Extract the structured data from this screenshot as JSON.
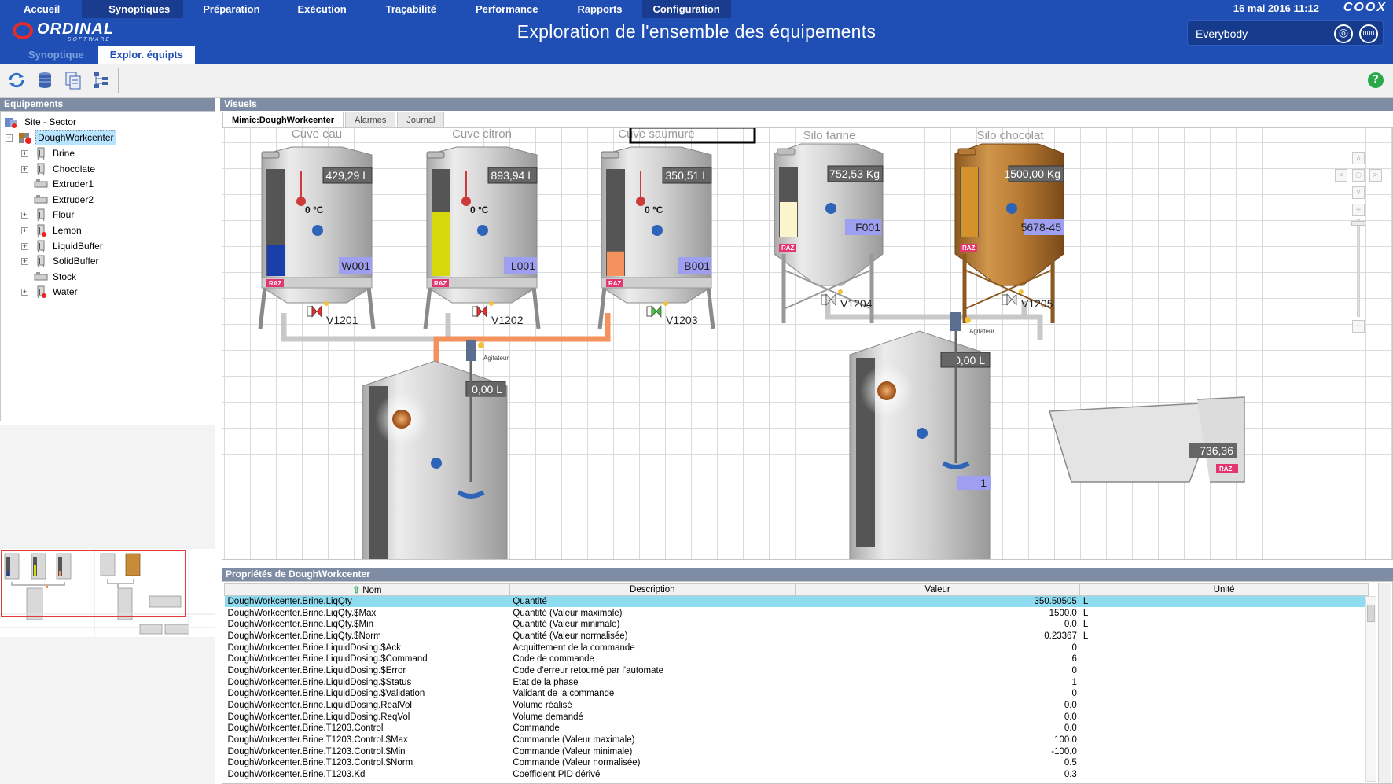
{
  "nav": {
    "items": [
      "Accueil",
      "Synoptiques",
      "Préparation",
      "Exécution",
      "Traçabilité",
      "Performance",
      "Rapports",
      "Configuration"
    ],
    "active": [
      "Synoptiques",
      "Configuration"
    ]
  },
  "logo": {
    "word": "ORDINAL",
    "sub": "SOFTWARE"
  },
  "header": {
    "title": "Exploration de l'ensemble des équipements",
    "datetime": "16 mai 2016 11:12",
    "brand": "COOX",
    "user": "Everybody",
    "user_btn_1": "◎",
    "user_btn_2": "000"
  },
  "subtabs": {
    "synoptique": "Synoptique",
    "explor": "Explor. équipts"
  },
  "toolbar": {
    "help": "?"
  },
  "left_panel": {
    "title": "Equipements",
    "tree": {
      "root": "Site - Sector",
      "workcenter": "DoughWorkcenter",
      "children": [
        "Brine",
        "Chocolate",
        "Extruder1",
        "Extruder2",
        "Flour",
        "Lemon",
        "LiquidBuffer",
        "SolidBuffer",
        "Stock",
        "Water"
      ]
    }
  },
  "visuels": {
    "title": "Visuels",
    "tabs": [
      "Mimic:DoughWorkcenter",
      "Alarmes",
      "Journal"
    ]
  },
  "mimic": {
    "tanks": [
      {
        "title": "Cuve eau",
        "volume": "429,29 L",
        "temp": "0 °C",
        "code": "W001",
        "valve": "V1201",
        "fill_color": "#1a3faa",
        "fill_level": 0.29
      },
      {
        "title": "Cuve citron",
        "volume": "893,94 L",
        "temp": "0 °C",
        "code": "L001",
        "valve": "V1202",
        "fill_color": "#d6d80c",
        "fill_level": 0.6
      },
      {
        "title": "Cuve saumure",
        "volume": "350,51 L",
        "temp": "0 °C",
        "code": "B001",
        "valve": "V1203",
        "fill_color": "#f4925e",
        "fill_level": 0.23
      }
    ],
    "silos": [
      {
        "title": "Silo farine",
        "volume": "752,53 Kg",
        "code": "F001",
        "valve": "V1204",
        "fill_color": "#fbf4cc",
        "fill_level": 0.5
      },
      {
        "title": "Silo chocolat",
        "volume": "1500,00 Kg",
        "code": "5678-45",
        "valve": "V1205",
        "fill_color": "#d4922a",
        "fill_level": 1.0
      }
    ],
    "mixer_left": {
      "volume": "0,00 L",
      "agitator": "Agitateur"
    },
    "mixer_right": {
      "volume": "0,00 L",
      "agitator": "Agitateur",
      "code": "1"
    },
    "bin": {
      "value": "736,36"
    },
    "raz": "RAZ",
    "colors": {
      "pipe_gray": "#c8c8c8",
      "pipe_active": "#f4925e",
      "valve_closed": "#e53030",
      "valve_open": "#3cc43c",
      "code_tag": "#9f9ff2"
    }
  },
  "props": {
    "title": "Propriétés de DoughWorkcenter",
    "columns": [
      "Nom",
      "Description",
      "Valeur",
      "Unité"
    ],
    "rows": [
      [
        "DoughWorkcenter.Brine.LiqQty",
        "Quantité",
        "350.50505",
        "L"
      ],
      [
        "DoughWorkcenter.Brine.LiqQty.$Max",
        "Quantité (Valeur maximale)",
        "1500.0",
        "L"
      ],
      [
        "DoughWorkcenter.Brine.LiqQty.$Min",
        "Quantité (Valeur minimale)",
        "0.0",
        "L"
      ],
      [
        "DoughWorkcenter.Brine.LiqQty.$Norm",
        "Quantité (Valeur normalisée)",
        "0.23367",
        "L"
      ],
      [
        "DoughWorkcenter.Brine.LiquidDosing.$Ack",
        "Acquittement de la commande",
        "0",
        ""
      ],
      [
        "DoughWorkcenter.Brine.LiquidDosing.$Command",
        "Code de commande",
        "6",
        ""
      ],
      [
        "DoughWorkcenter.Brine.LiquidDosing.$Error",
        "Code d'erreur retourné par l'automate",
        "0",
        ""
      ],
      [
        "DoughWorkcenter.Brine.LiquidDosing.$Status",
        "Etat de la phase",
        "1",
        ""
      ],
      [
        "DoughWorkcenter.Brine.LiquidDosing.$Validation",
        "Validant de la commande",
        "0",
        ""
      ],
      [
        "DoughWorkcenter.Brine.LiquidDosing.RealVol",
        "Volume réalisé",
        "0.0",
        ""
      ],
      [
        "DoughWorkcenter.Brine.LiquidDosing.ReqVol",
        "Volume demandé",
        "0.0",
        ""
      ],
      [
        "DoughWorkcenter.Brine.T1203.Control",
        "Commande",
        "0.0",
        ""
      ],
      [
        "DoughWorkcenter.Brine.T1203.Control.$Max",
        "Commande (Valeur maximale)",
        "100.0",
        ""
      ],
      [
        "DoughWorkcenter.Brine.T1203.Control.$Min",
        "Commande (Valeur minimale)",
        "-100.0",
        ""
      ],
      [
        "DoughWorkcenter.Brine.T1203.Control.$Norm",
        "Commande (Valeur normalisée)",
        "0.5",
        ""
      ],
      [
        "DoughWorkcenter.Brine.T1203.Kd",
        "Coefficient PID dérivé",
        "0.3",
        ""
      ]
    ]
  }
}
